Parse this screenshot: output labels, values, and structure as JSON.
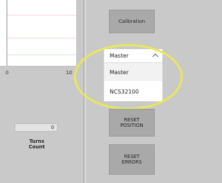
{
  "chart": {
    "x_tick_left": "0",
    "x_tick_right": "10"
  },
  "buttons": {
    "calibration": "Calibration",
    "reset_position": "RESET\nPOSITION",
    "reset_errors": "RESET\nERRORS"
  },
  "dropdown": {
    "selected": "Master",
    "options": [
      "Master",
      "NCS32100"
    ]
  },
  "turns": {
    "value": "0",
    "label": "Turns\nCount"
  },
  "colors": {
    "highlight": "#e8e85a",
    "button_gray": "#a9a9a9",
    "panel_bg": "#c9c9c9"
  }
}
